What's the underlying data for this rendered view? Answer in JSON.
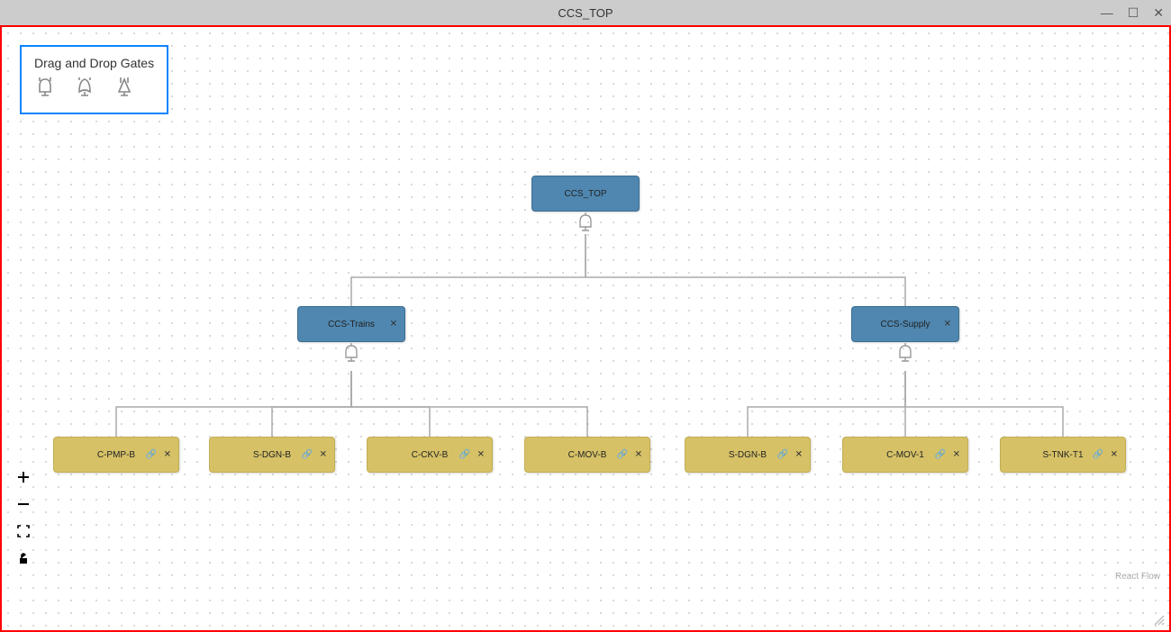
{
  "window": {
    "title": "CCS_TOP"
  },
  "palette": {
    "title": "Drag and Drop Gates"
  },
  "attribution": "React Flow",
  "tree": {
    "root": {
      "label": "CCS_TOP"
    },
    "gates": [
      {
        "id": "ccs-trains",
        "label": "CCS-Trains"
      },
      {
        "id": "ccs-supply",
        "label": "CCS-Supply"
      }
    ],
    "leaves_left": [
      {
        "id": "c-pmp-b",
        "label": "C-PMP-B"
      },
      {
        "id": "s-dgn-b",
        "label": "S-DGN-B"
      },
      {
        "id": "c-ckv-b",
        "label": "C-CKV-B"
      },
      {
        "id": "c-mov-b",
        "label": "C-MOV-B"
      }
    ],
    "leaves_right": [
      {
        "id": "s-dgn-b-2",
        "label": "S-DGN-B"
      },
      {
        "id": "c-mov-1",
        "label": "C-MOV-1"
      },
      {
        "id": "s-tnk-t1",
        "label": "S-TNK-T1"
      }
    ]
  }
}
